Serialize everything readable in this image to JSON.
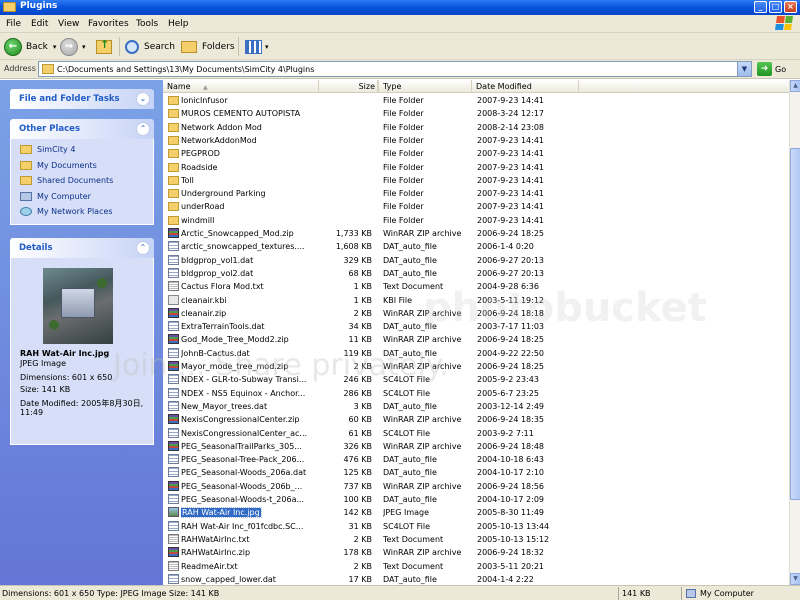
{
  "window": {
    "title": "Plugins",
    "controls": {
      "minimize": "_",
      "maximize": "□",
      "close": "×"
    }
  },
  "menu": [
    "File",
    "Edit",
    "View",
    "Favorites",
    "Tools",
    "Help"
  ],
  "toolbar": {
    "back_label": "Back",
    "search_label": "Search",
    "folders_label": "Folders"
  },
  "address": {
    "label": "Address",
    "value": "C:\\Documents and Settings\\13\\My Documents\\SimCity 4\\Plugins",
    "go_label": "Go"
  },
  "taskpane": {
    "file_folder_tasks_title": "File and Folder Tasks",
    "other_places_title": "Other Places",
    "other_places": [
      {
        "label": "SimCity 4",
        "icon": "folder-icon"
      },
      {
        "label": "My Documents",
        "icon": "folder-icon"
      },
      {
        "label": "Shared Documents",
        "icon": "folder-icon"
      },
      {
        "label": "My Computer",
        "icon": "computer-icon"
      },
      {
        "label": "My Network Places",
        "icon": "network-icon"
      }
    ],
    "details_title": "Details",
    "details": {
      "filename": "RAH Wat-Air Inc.jpg",
      "filetype": "JPEG Image",
      "dimensions": "Dimensions: 601 x 650",
      "size": "Size: 141 KB",
      "modified_line1": "Date Modified: 2005年8月30日,",
      "modified_line2": "11:49"
    }
  },
  "columns": {
    "name": "Name",
    "size": "Size",
    "type": "Type",
    "date": "Date Modified"
  },
  "files": [
    {
      "name": "IonicInfusor",
      "size": "",
      "type": "File Folder",
      "date": "2007-9-23 14:41",
      "icon": "folder"
    },
    {
      "name": "MUROS CEMENTO AUTOPISTA",
      "size": "",
      "type": "File Folder",
      "date": "2008-3-24 12:17",
      "icon": "folder"
    },
    {
      "name": "Network Addon Mod",
      "size": "",
      "type": "File Folder",
      "date": "2008-2-14 23:08",
      "icon": "folder"
    },
    {
      "name": "NetworkAddonMod",
      "size": "",
      "type": "File Folder",
      "date": "2007-9-23 14:41",
      "icon": "folder"
    },
    {
      "name": "PEGPROD",
      "size": "",
      "type": "File Folder",
      "date": "2007-9-23 14:41",
      "icon": "folder"
    },
    {
      "name": "Roadside",
      "size": "",
      "type": "File Folder",
      "date": "2007-9-23 14:41",
      "icon": "folder"
    },
    {
      "name": "Toll",
      "size": "",
      "type": "File Folder",
      "date": "2007-9-23 14:41",
      "icon": "folder"
    },
    {
      "name": "Underground Parking",
      "size": "",
      "type": "File Folder",
      "date": "2007-9-23 14:41",
      "icon": "folder"
    },
    {
      "name": "underRoad",
      "size": "",
      "type": "File Folder",
      "date": "2007-9-23 14:41",
      "icon": "folder"
    },
    {
      "name": "windmill",
      "size": "",
      "type": "File Folder",
      "date": "2007-9-23 14:41",
      "icon": "folder"
    },
    {
      "name": "Arctic_Snowcapped_Mod.zip",
      "size": "1,733 KB",
      "type": "WinRAR ZIP archive",
      "date": "2006-9-24 18:25",
      "icon": "zip"
    },
    {
      "name": "arctic_snowcapped_textures....",
      "size": "1,608 KB",
      "type": "DAT_auto_file",
      "date": "2006-1-4 0:20",
      "icon": "dat"
    },
    {
      "name": "bldgprop_vol1.dat",
      "size": "329 KB",
      "type": "DAT_auto_file",
      "date": "2006-9-27 20:13",
      "icon": "dat"
    },
    {
      "name": "bldgprop_vol2.dat",
      "size": "68 KB",
      "type": "DAT_auto_file",
      "date": "2006-9-27 20:13",
      "icon": "dat"
    },
    {
      "name": "Cactus Flora Mod.txt",
      "size": "1 KB",
      "type": "Text Document",
      "date": "2004-9-28 6:36",
      "icon": "txt"
    },
    {
      "name": "cleanair.kbi",
      "size": "1 KB",
      "type": "KBI File",
      "date": "2003-5-11 19:12",
      "icon": "kbi"
    },
    {
      "name": "cleanair.zip",
      "size": "2 KB",
      "type": "WinRAR ZIP archive",
      "date": "2006-9-24 18:18",
      "icon": "zip"
    },
    {
      "name": "ExtraTerrainTools.dat",
      "size": "34 KB",
      "type": "DAT_auto_file",
      "date": "2003-7-17 11:03",
      "icon": "dat"
    },
    {
      "name": "God_Mode_Tree_Modd2.zip",
      "size": "11 KB",
      "type": "WinRAR ZIP archive",
      "date": "2006-9-24 18:25",
      "icon": "zip"
    },
    {
      "name": "JohnB-Cactus.dat",
      "size": "119 KB",
      "type": "DAT_auto_file",
      "date": "2004-9-22 22:50",
      "icon": "dat"
    },
    {
      "name": "Mayor_mode_tree_mod.zip",
      "size": "2 KB",
      "type": "WinRAR ZIP archive",
      "date": "2006-9-24 18:25",
      "icon": "zip"
    },
    {
      "name": "NDEX - GLR-to-Subway Transi...",
      "size": "246 KB",
      "type": "SC4LOT File",
      "date": "2005-9-2 23:43",
      "icon": "lot"
    },
    {
      "name": "NDEX - NS5 Equinox - Anchor...",
      "size": "286 KB",
      "type": "SC4LOT File",
      "date": "2005-6-7 23:25",
      "icon": "lot"
    },
    {
      "name": "New_Mayor_trees.dat",
      "size": "3 KB",
      "type": "DAT_auto_file",
      "date": "2003-12-14 2:49",
      "icon": "dat"
    },
    {
      "name": "NexisCongressionalCenter.zip",
      "size": "60 KB",
      "type": "WinRAR ZIP archive",
      "date": "2006-9-24 18:35",
      "icon": "zip"
    },
    {
      "name": "NexisCongressionalCenter_ac...",
      "size": "61 KB",
      "type": "SC4LOT File",
      "date": "2003-9-2 7:11",
      "icon": "lot"
    },
    {
      "name": "PEG_SeasonalTrailParks_305...",
      "size": "326 KB",
      "type": "WinRAR ZIP archive",
      "date": "2006-9-24 18:48",
      "icon": "zip"
    },
    {
      "name": "PEG_Seasonal-Tree-Pack_206...",
      "size": "476 KB",
      "type": "DAT_auto_file",
      "date": "2004-10-18 6:43",
      "icon": "dat"
    },
    {
      "name": "PEG_Seasonal-Woods_206a.dat",
      "size": "125 KB",
      "type": "DAT_auto_file",
      "date": "2004-10-17 2:10",
      "icon": "dat"
    },
    {
      "name": "PEG_Seasonal-Woods_206b_...",
      "size": "737 KB",
      "type": "WinRAR ZIP archive",
      "date": "2006-9-24 18:56",
      "icon": "zip"
    },
    {
      "name": "PEG_Seasonal-Woods-t_206a...",
      "size": "100 KB",
      "type": "DAT_auto_file",
      "date": "2004-10-17 2:09",
      "icon": "dat"
    },
    {
      "name": "RAH Wat-Air Inc.jpg",
      "size": "142 KB",
      "type": "JPEG Image",
      "date": "2005-8-30 11:49",
      "icon": "jpg",
      "selected": true
    },
    {
      "name": "RAH Wat-Air Inc_f01fcdbc.SC...",
      "size": "31 KB",
      "type": "SC4LOT File",
      "date": "2005-10-13 13:44",
      "icon": "lot"
    },
    {
      "name": "RAHWatAirInc.txt",
      "size": "2 KB",
      "type": "Text Document",
      "date": "2005-10-13 15:12",
      "icon": "txt"
    },
    {
      "name": "RAHWatAirInc.zip",
      "size": "178 KB",
      "type": "WinRAR ZIP archive",
      "date": "2006-9-24 18:32",
      "icon": "zip"
    },
    {
      "name": "ReadmeAir.txt",
      "size": "2 KB",
      "type": "Text Document",
      "date": "2003-5-11 20:21",
      "icon": "txt"
    },
    {
      "name": "snow_capped_lower.dat",
      "size": "17 KB",
      "type": "DAT_auto_file",
      "date": "2004-1-4 2:22",
      "icon": "dat"
    }
  ],
  "status": {
    "info": "Dimensions: 601 x 650 Type: JPEG Image Size: 141 KB",
    "size": "141 KB",
    "location": "My Computer"
  },
  "watermark": {
    "line1": "photobucket",
    "line2": "Join ... Share privately."
  },
  "colors": {
    "titlebar": "#0a55de",
    "taskpane": "#6f8fe0",
    "selection": "#316ac5"
  }
}
